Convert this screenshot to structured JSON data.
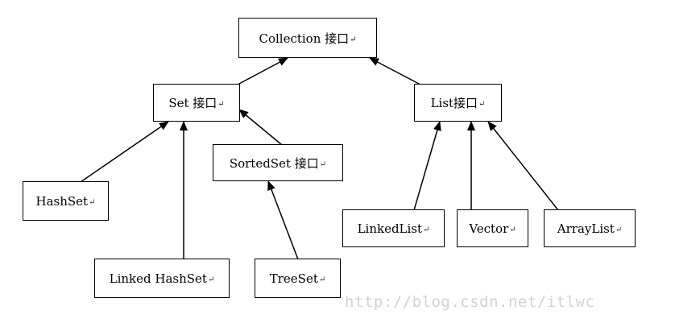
{
  "nodes": {
    "collection": {
      "label": "Collection 接口",
      "mark": "↵"
    },
    "set": {
      "label": "Set 接口",
      "mark": "↵"
    },
    "list": {
      "label": "List接口",
      "mark": "↵"
    },
    "sortedset": {
      "label": "SortedSet 接口",
      "mark": "↵"
    },
    "hashset": {
      "label": "HashSet",
      "mark": "↵"
    },
    "linkedhashset": {
      "label": "Linked HashSet",
      "mark": "↵"
    },
    "treeset": {
      "label": "TreeSet",
      "mark": "↵"
    },
    "linkedlist": {
      "label": "LinkedList",
      "mark": "↵"
    },
    "vector": {
      "label": "Vector",
      "mark": "↵"
    },
    "arraylist": {
      "label": "ArrayList",
      "mark": "↵"
    }
  },
  "edges": [
    {
      "from": "set",
      "to": "collection"
    },
    {
      "from": "list",
      "to": "collection"
    },
    {
      "from": "hashset",
      "to": "set"
    },
    {
      "from": "linkedhashset",
      "to": "set"
    },
    {
      "from": "sortedset",
      "to": "set"
    },
    {
      "from": "treeset",
      "to": "sortedset"
    },
    {
      "from": "linkedlist",
      "to": "list"
    },
    {
      "from": "vector",
      "to": "list"
    },
    {
      "from": "arraylist",
      "to": "list"
    }
  ],
  "watermark": "http://blog.csdn.net/itlwc"
}
